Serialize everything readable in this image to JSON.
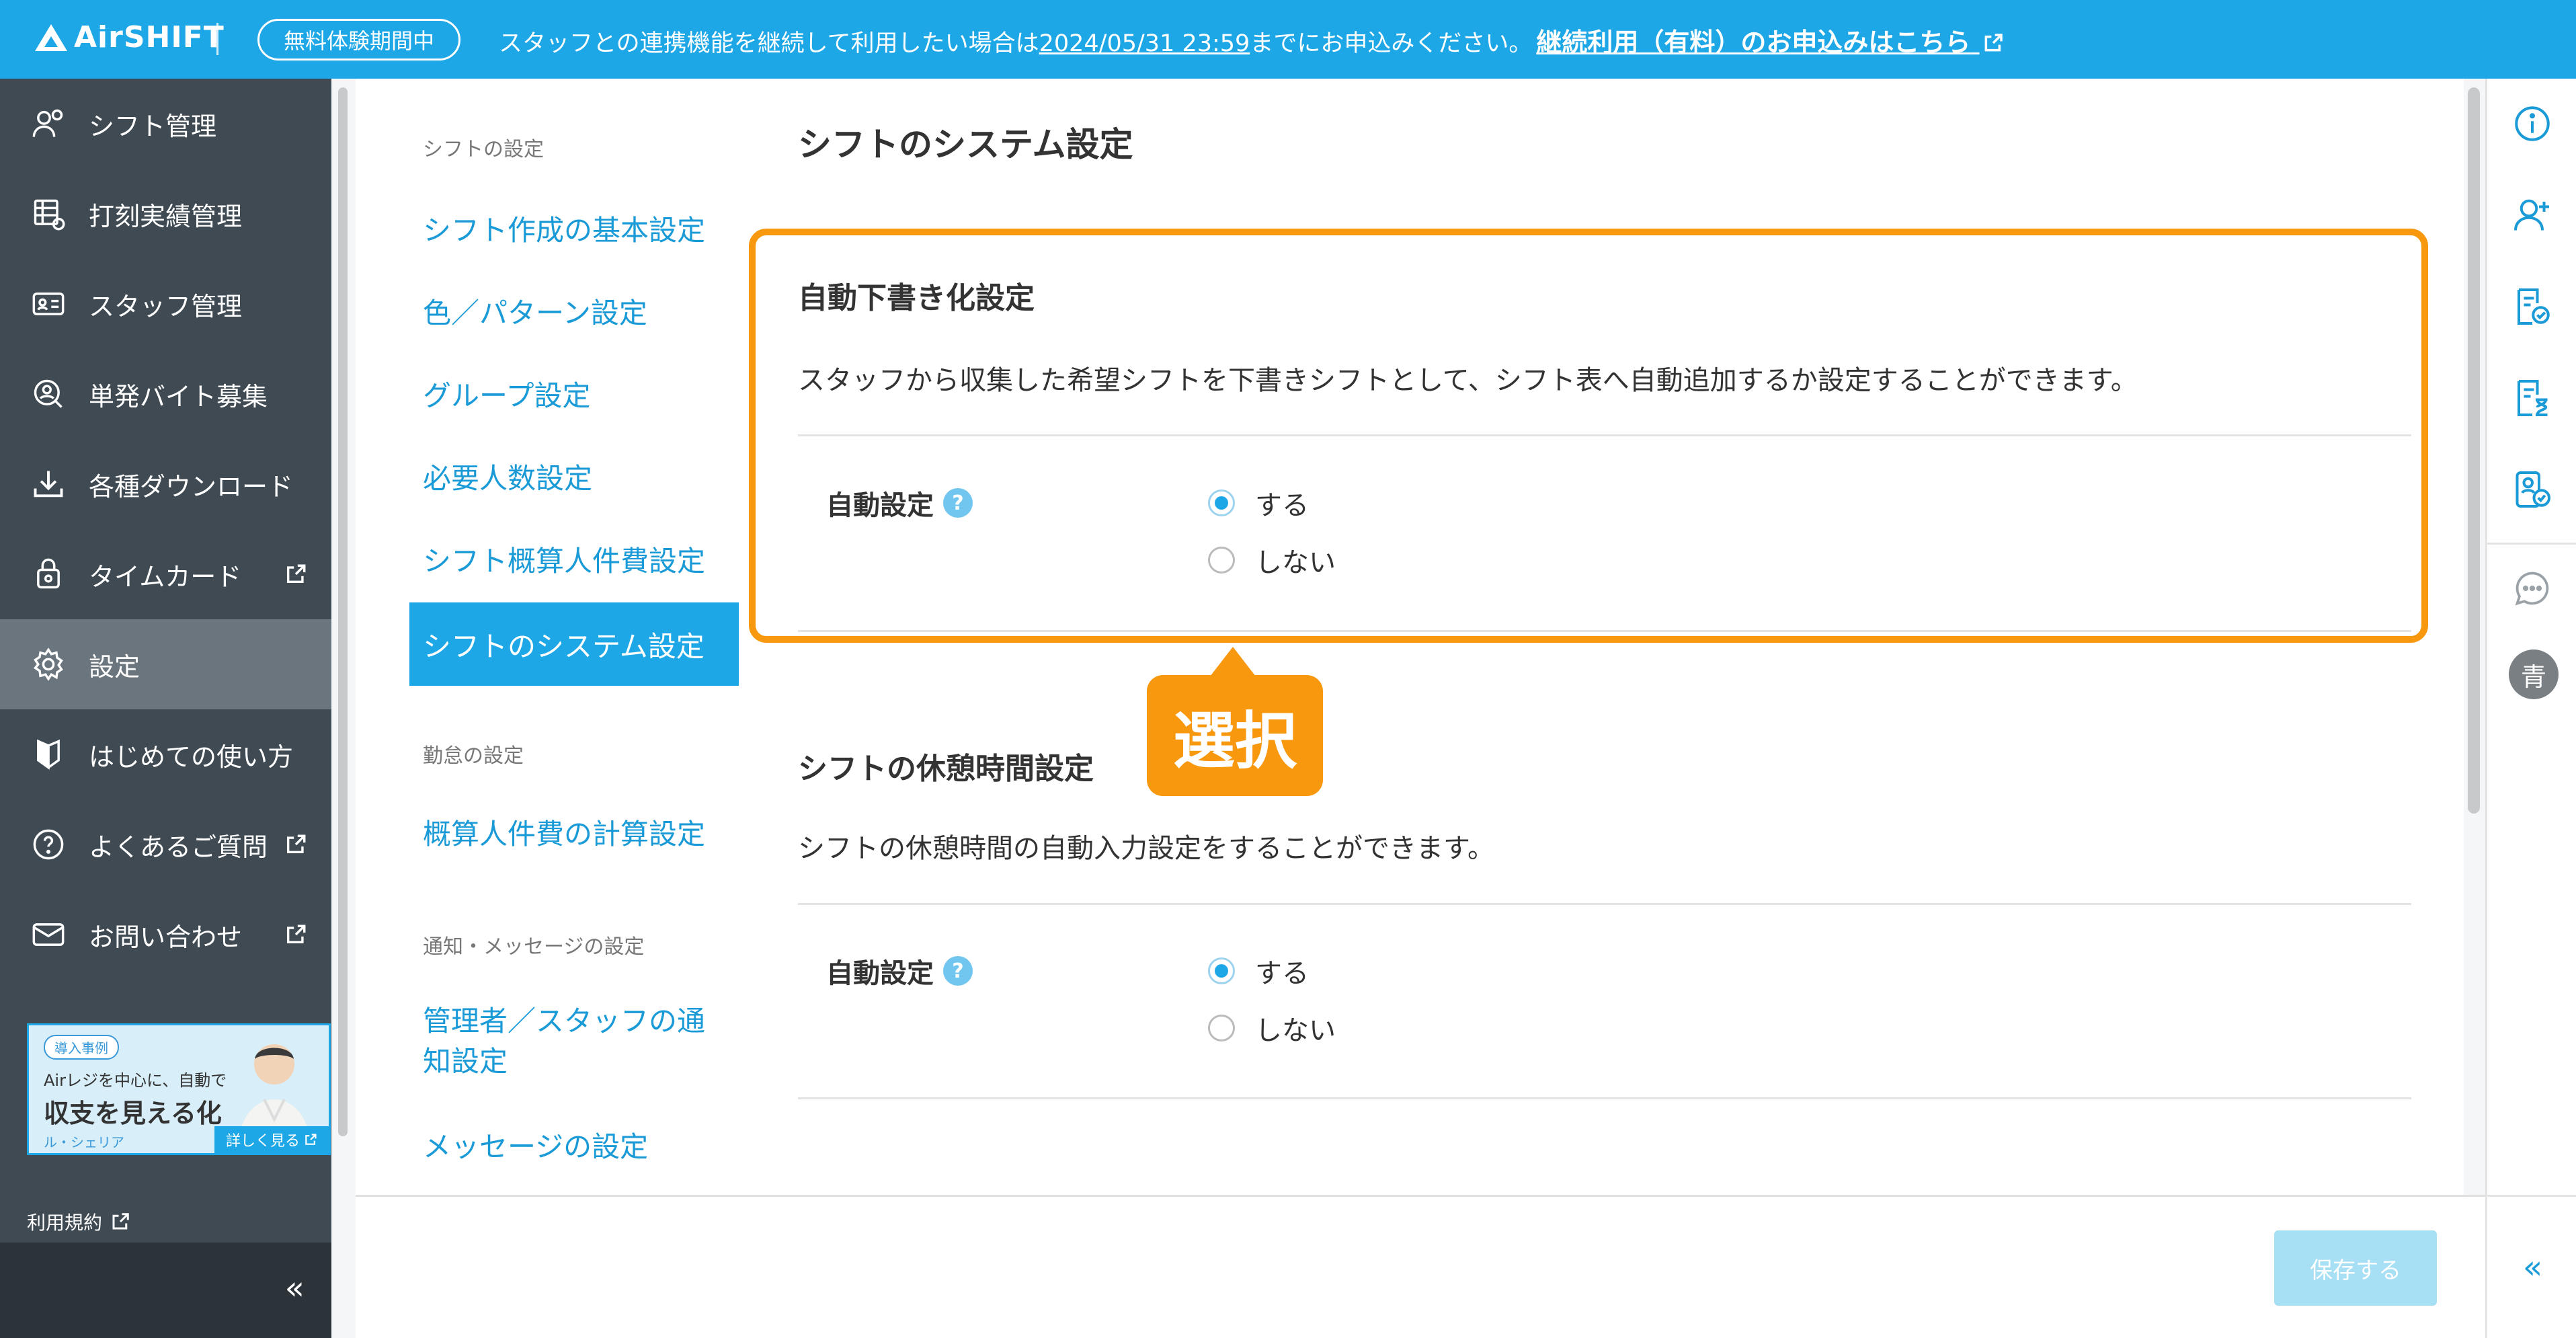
{
  "banner": {
    "logo": "AirSHIFT",
    "trial_badge": "無料体験期間中",
    "message_pre": "スタッフとの連携機能を継続して利用したい場合は",
    "deadline": "2024/05/31 23:59",
    "message_post": "までにお申込みください。",
    "cta_link": "継続利用（有料）のお申込みはこちら",
    "color": "#1ea7e6"
  },
  "sidebar": {
    "items": [
      {
        "label": "シフト管理",
        "icon": "people-gear-icon",
        "external": false
      },
      {
        "label": "打刻実績管理",
        "icon": "timecard-list-icon",
        "external": false
      },
      {
        "label": "スタッフ管理",
        "icon": "id-card-icon",
        "external": false
      },
      {
        "label": "単発バイト募集",
        "icon": "person-search-icon",
        "external": false
      },
      {
        "label": "各種ダウンロード",
        "icon": "download-icon",
        "external": false
      },
      {
        "label": "タイムカード",
        "icon": "timecard-lock-icon",
        "external": true
      },
      {
        "label": "設定",
        "icon": "gear-icon",
        "external": false,
        "active": true
      },
      {
        "label": "はじめての使い方",
        "icon": "beginner-mark-icon",
        "external": false
      },
      {
        "label": "よくあるご質問",
        "icon": "question-circle-icon",
        "external": true
      },
      {
        "label": "お問い合わせ",
        "icon": "mail-icon",
        "external": true
      }
    ],
    "ad": {
      "tag": "導入事例",
      "line1": "Airレジを中心に、自動で",
      "line2": "収支を見える化",
      "line3": "ル・シェリア",
      "more": "詳しく見る"
    },
    "terms": "利用規約",
    "collapse": "«",
    "bg_color": "#3f4a53"
  },
  "settings_nav": {
    "sections": [
      {
        "heading": "シフトの設定",
        "links": [
          "シフト作成の基本設定",
          "色／パターン設定",
          "グループ設定",
          "必要人数設定",
          "シフト概算人件費設定",
          "シフトのシステム設定"
        ]
      },
      {
        "heading": "勤怠の設定",
        "links": [
          "概算人件費の計算設定"
        ]
      },
      {
        "heading": "通知・メッセージの設定",
        "links": [
          "管理者／スタッフの通知設定",
          "メッセージの設定"
        ]
      }
    ],
    "active": "シフトのシステム設定"
  },
  "main": {
    "title": "シフトのシステム設定",
    "cards": [
      {
        "title": "自動下書き化設定",
        "description": "スタッフから収集した希望シフトを下書きシフトとして、シフト表へ自動追加するか設定することができます。",
        "field_label": "自動設定",
        "options": [
          "する",
          "しない"
        ],
        "selected": "する"
      },
      {
        "title": "シフトの休憩時間設定",
        "description": "シフトの休憩時間の自動入力設定をすることができます。",
        "field_label": "自動設定",
        "options": [
          "する",
          "しない"
        ],
        "selected": "する"
      }
    ]
  },
  "callout": {
    "text": "選択",
    "color": "#f7980f"
  },
  "save_button": "保存する",
  "right_rail": {
    "icons": [
      "info-icon",
      "add-person-icon",
      "doc-check-icon",
      "doc-hourglass-icon",
      "badge-check-icon",
      "chat-icon"
    ],
    "avatar": "青",
    "collapse": "«"
  }
}
